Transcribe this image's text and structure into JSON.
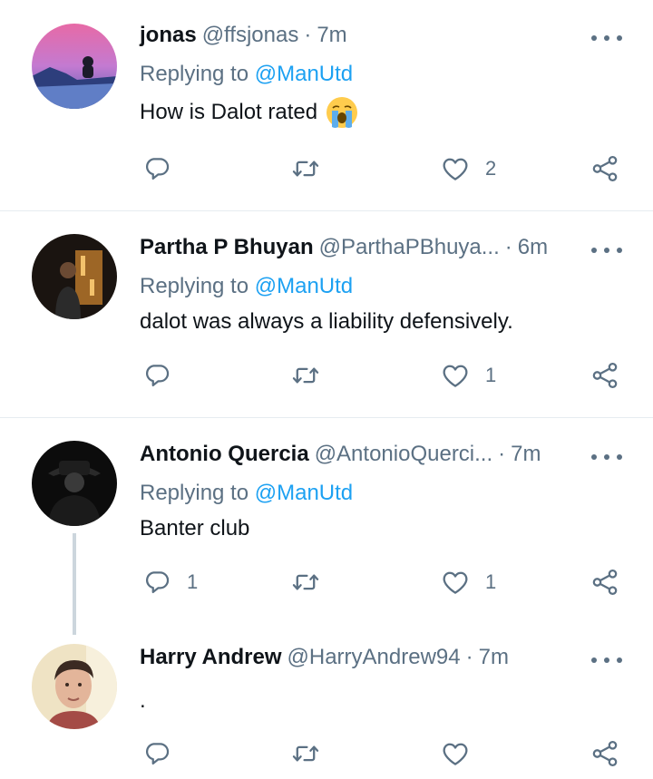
{
  "reply_prefix": "Replying to ",
  "tweets": [
    {
      "name": "jonas",
      "handle": "@ffsjonas",
      "dot": "·",
      "time": "7m",
      "reply_to": "@ManUtd",
      "text": "How is Dalot rated",
      "emoji": "loudly-crying-face",
      "reply_count": "",
      "retweet_count": "",
      "like_count": "2"
    },
    {
      "name": "Partha P Bhuyan",
      "handle": "@ParthaPBhuya...",
      "dot": "·",
      "time": "6m",
      "reply_to": "@ManUtd",
      "text": "dalot was always a liability defensively.",
      "reply_count": "",
      "retweet_count": "",
      "like_count": "1"
    },
    {
      "name": "Antonio Quercia",
      "handle": "@AntonioQuerci...",
      "dot": "·",
      "time": "7m",
      "reply_to": "@ManUtd",
      "text": "Banter club",
      "reply_count": "1",
      "retweet_count": "",
      "like_count": "1"
    },
    {
      "name": "Harry Andrew",
      "handle": "@HarryAndrew94",
      "dot": "·",
      "time": "7m",
      "text": ".",
      "reply_count": "",
      "retweet_count": "",
      "like_count": ""
    }
  ],
  "colors": {
    "mention": "#1da1f2",
    "secondary_text": "#5b7083",
    "primary_text": "#0f1419",
    "divider": "#e6ecf0",
    "thread_line": "#ccd6dd"
  },
  "icons": {
    "more": "more-dots-icon",
    "reply": "reply-bubble-icon",
    "retweet": "retweet-icon",
    "like": "heart-icon",
    "share": "share-icon"
  }
}
